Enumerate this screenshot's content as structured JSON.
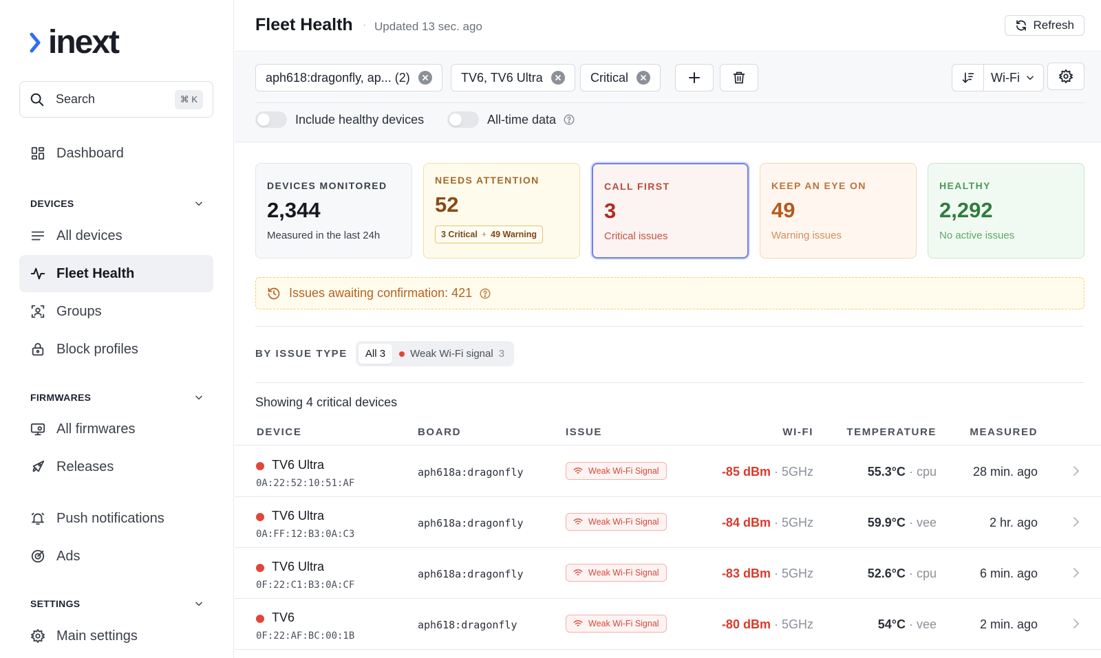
{
  "logo": {
    "text": "inext"
  },
  "search": {
    "placeholder": "Search",
    "shortcut": "⌘ K"
  },
  "nav": {
    "dashboard": "Dashboard",
    "devices_section": "DEVICES",
    "all_devices": "All devices",
    "fleet_health": "Fleet Health",
    "groups": "Groups",
    "block_profiles": "Block profiles",
    "firmwares_section": "FIRMWARES",
    "all_firmwares": "All firmwares",
    "releases": "Releases",
    "push_notifications": "Push notifications",
    "ads": "Ads",
    "settings_section": "SETTINGS",
    "main_settings": "Main settings"
  },
  "header": {
    "title": "Fleet Health",
    "separator": "·",
    "updated": "Updated 13 sec. ago",
    "refresh": "Refresh"
  },
  "filters": {
    "chips": [
      "aph618:dragonfly, ap... (2)",
      "TV6, TV6 Ultra",
      "Critical"
    ],
    "sort_value": "Wi-Fi",
    "toggles": {
      "include_healthy": "Include healthy devices",
      "all_time": "All-time data"
    }
  },
  "stats": {
    "monitored": {
      "label": "DEVICES MONITORED",
      "value": "2,344",
      "sub": "Measured in the last 24h"
    },
    "attention": {
      "label": "NEEDS ATTENTION",
      "value": "52",
      "critical": "3 Critical",
      "plus": "+",
      "warning": "49 Warning"
    },
    "call_first": {
      "label": "CALL FIRST",
      "value": "3",
      "sub": "Critical issues"
    },
    "keep_eye": {
      "label": "KEEP AN EYE ON",
      "value": "49",
      "sub": "Warning issues"
    },
    "healthy": {
      "label": "HEALTHY",
      "value": "2,292",
      "sub": "No active issues"
    }
  },
  "awaiting": "Issues awaiting confirmation: 421",
  "issue_type": {
    "label": "BY ISSUE TYPE",
    "all": "All 3",
    "weak_wifi": "Weak Wi-Fi signal",
    "weak_wifi_count": "3"
  },
  "showing": "Showing 4 critical devices",
  "table": {
    "columns": {
      "device": "DEVICE",
      "board": "BOARD",
      "issue": "ISSUE",
      "wifi": "WI-FI",
      "temperature": "TEMPERATURE",
      "measured": "MEASURED"
    },
    "sep": "·",
    "rows": [
      {
        "name": "TV6 Ultra",
        "mac": "0A:22:52:10:51:AF",
        "board": "aph618a:dragonfly",
        "issue": "Weak Wi-Fi Signal",
        "dbm": "-85 dBm",
        "band": "5GHz",
        "temp": "55.3°C",
        "sensor": "cpu",
        "measured": "28 min. ago"
      },
      {
        "name": "TV6 Ultra",
        "mac": "0A:FF:12:B3:0A:C3",
        "board": "aph618a:dragonfly",
        "issue": "Weak Wi-Fi Signal",
        "dbm": "-84 dBm",
        "band": "5GHz",
        "temp": "59.9°C",
        "sensor": "vee",
        "measured": "2 hr. ago"
      },
      {
        "name": "TV6 Ultra",
        "mac": "0F:22:C1:B3:0A:CF",
        "board": "aph618a:dragonfly",
        "issue": "Weak Wi-Fi Signal",
        "dbm": "-83 dBm",
        "band": "5GHz",
        "temp": "52.6°C",
        "sensor": "cpu",
        "measured": "6 min. ago"
      },
      {
        "name": "TV6",
        "mac": "0F:22:AF:BC:00:1B",
        "board": "aph618:dragonfly",
        "issue": "Weak Wi-Fi Signal",
        "dbm": "-80 dBm",
        "band": "5GHz",
        "temp": "54°C",
        "sensor": "vee",
        "measured": "2 min. ago"
      }
    ]
  },
  "colors": {
    "accent": "#2f6fed",
    "critical": "#e0463a",
    "warning": "#b8581c",
    "healthy": "#2e7d3c"
  }
}
